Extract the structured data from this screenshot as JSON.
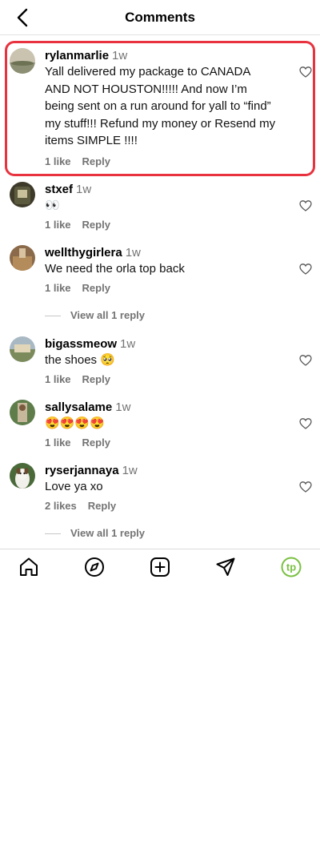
{
  "header": {
    "title": "Comments",
    "back_icon": "chevron-left-icon"
  },
  "comments": [
    {
      "username": "rylanmarlie",
      "time": "1w",
      "text": "Yall delivered my package to CANADA AND NOT HOUSTON!!!!! And now I’m being sent on a run around for yall to “find” my stuff!!! Refund my money or Resend my items SIMPLE !!!!",
      "likes": "1 like",
      "reply": "Reply"
    },
    {
      "username": "stxef",
      "time": "1w",
      "text": "👀",
      "likes": "1 like",
      "reply": "Reply"
    },
    {
      "username": "wellthygirlera",
      "time": "1w",
      "text": "We need the orla top back",
      "likes": "1 like",
      "reply": "Reply",
      "view_replies": "View all 1 reply"
    },
    {
      "username": "bigassmeow",
      "time": "1w",
      "text": "the shoes 🥺",
      "likes": "1 like",
      "reply": "Reply"
    },
    {
      "username": "sallysalame",
      "time": "1w",
      "text": "😍😍😍😍",
      "likes": "1 like",
      "reply": "Reply"
    },
    {
      "username": "ryserjannaya",
      "time": "1w",
      "text": "Love ya xo",
      "likes": "2 likes",
      "reply": "Reply",
      "view_replies": "View all 1 reply"
    }
  ],
  "tabbar": {
    "items": [
      "home-icon",
      "explore-icon",
      "create-icon",
      "direct-message-icon",
      "profile-avatar-icon"
    ],
    "profile_initials": "tp",
    "profile_color": "#7ac142"
  },
  "colors": {
    "highlight": "#e8323f",
    "secondary_text": "#737373"
  }
}
